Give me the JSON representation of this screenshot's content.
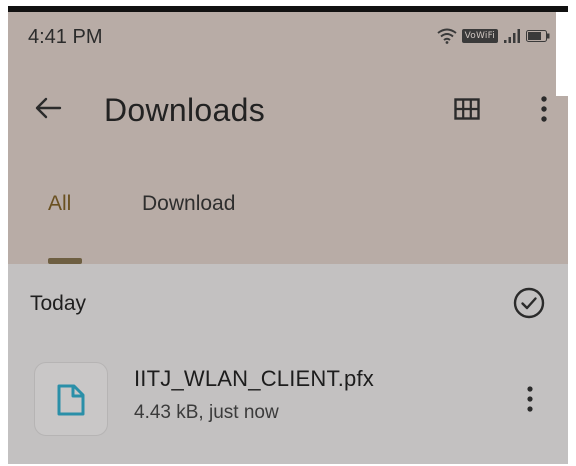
{
  "status_bar": {
    "time": "4:41 PM",
    "vowifi_label": "VoWiFi",
    "icons": [
      "wifi-icon",
      "signal-icon",
      "battery-icon"
    ]
  },
  "app_bar": {
    "title": "Downloads",
    "icons": [
      "back-arrow-icon",
      "grid-view-icon",
      "more-vert-icon"
    ]
  },
  "tabs": [
    {
      "label": "All",
      "selected": true
    },
    {
      "label": "Download",
      "selected": false
    }
  ],
  "sheet": {
    "section_title": "Today",
    "select_icon": "check-circle-icon",
    "files": [
      {
        "name": "IITJ_WLAN_CLIENT.pfx",
        "meta": "4.43 kB, just now",
        "icon": "file-icon"
      }
    ]
  },
  "colors": {
    "scrim": "#b8aca6",
    "sheet_bg": "#c3c1c1",
    "selected_tab": "#6a5020",
    "file_icon": "#2a8fa8"
  }
}
